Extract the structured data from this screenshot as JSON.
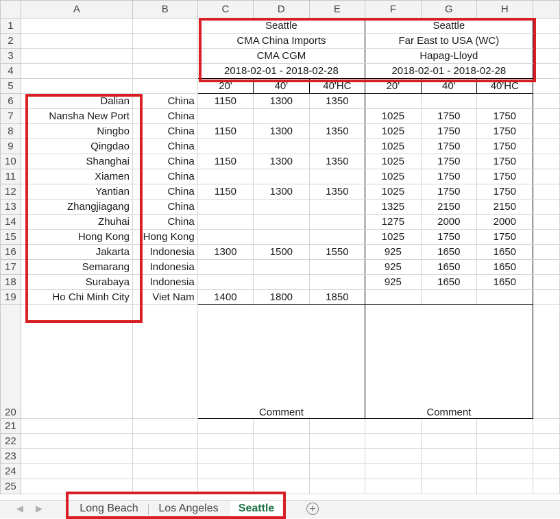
{
  "columns": [
    "A",
    "B",
    "C",
    "D",
    "E",
    "F",
    "G",
    "H"
  ],
  "rows": [
    "1",
    "2",
    "3",
    "4",
    "5",
    "6",
    "7",
    "8",
    "9",
    "10",
    "11",
    "12",
    "13",
    "14",
    "15",
    "16",
    "17",
    "18",
    "19",
    "20",
    "21",
    "22",
    "23",
    "24",
    "25"
  ],
  "header": {
    "left": {
      "city": "Seattle",
      "service": "CMA China Imports",
      "carrier": "CMA CGM",
      "period": "2018-02-01 - 2018-02-28"
    },
    "right": {
      "city": "Seattle",
      "service": "Far East to USA (WC)",
      "carrier": "Hapag-Lloyd",
      "period": "2018-02-01 - 2018-02-28"
    }
  },
  "container_sizes": [
    "20'",
    "40'",
    "40'HC",
    "20'",
    "40'",
    "40'HC"
  ],
  "ports": [
    {
      "port": "Dalian",
      "country": "China",
      "cma": [
        "1150",
        "1300",
        "1350"
      ],
      "hapag": [
        "",
        "",
        ""
      ]
    },
    {
      "port": "Nansha New Port",
      "country": "China",
      "cma": [
        "",
        "",
        ""
      ],
      "hapag": [
        "1025",
        "1750",
        "1750"
      ]
    },
    {
      "port": "Ningbo",
      "country": "China",
      "cma": [
        "1150",
        "1300",
        "1350"
      ],
      "hapag": [
        "1025",
        "1750",
        "1750"
      ]
    },
    {
      "port": "Qingdao",
      "country": "China",
      "cma": [
        "",
        "",
        ""
      ],
      "hapag": [
        "1025",
        "1750",
        "1750"
      ]
    },
    {
      "port": "Shanghai",
      "country": "China",
      "cma": [
        "1150",
        "1300",
        "1350"
      ],
      "hapag": [
        "1025",
        "1750",
        "1750"
      ]
    },
    {
      "port": "Xiamen",
      "country": "China",
      "cma": [
        "",
        "",
        ""
      ],
      "hapag": [
        "1025",
        "1750",
        "1750"
      ]
    },
    {
      "port": "Yantian",
      "country": "China",
      "cma": [
        "1150",
        "1300",
        "1350"
      ],
      "hapag": [
        "1025",
        "1750",
        "1750"
      ]
    },
    {
      "port": "Zhangjiagang",
      "country": "China",
      "cma": [
        "",
        "",
        ""
      ],
      "hapag": [
        "1325",
        "2150",
        "2150"
      ]
    },
    {
      "port": "Zhuhai",
      "country": "China",
      "cma": [
        "",
        "",
        ""
      ],
      "hapag": [
        "1275",
        "2000",
        "2000"
      ]
    },
    {
      "port": "Hong Kong",
      "country": "Hong Kong",
      "cma": [
        "",
        "",
        ""
      ],
      "hapag": [
        "1025",
        "1750",
        "1750"
      ]
    },
    {
      "port": "Jakarta",
      "country": "Indonesia",
      "cma": [
        "1300",
        "1500",
        "1550"
      ],
      "hapag": [
        "925",
        "1650",
        "1650"
      ]
    },
    {
      "port": "Semarang",
      "country": "Indonesia",
      "cma": [
        "",
        "",
        ""
      ],
      "hapag": [
        "925",
        "1650",
        "1650"
      ]
    },
    {
      "port": "Surabaya",
      "country": "Indonesia",
      "cma": [
        "",
        "",
        ""
      ],
      "hapag": [
        "925",
        "1650",
        "1650"
      ]
    },
    {
      "port": "Ho Chi Minh City",
      "country": "Viet Nam",
      "cma": [
        "1400",
        "1800",
        "1850"
      ],
      "hapag": [
        "",
        "",
        ""
      ]
    }
  ],
  "comment_label": "Comment",
  "sheet_tabs": [
    {
      "label": "Long Beach",
      "active": false
    },
    {
      "label": "Los Angeles",
      "active": false
    },
    {
      "label": "Seattle",
      "active": true
    }
  ],
  "nav": {
    "prev": "◀",
    "next": "▶",
    "add": "+"
  },
  "highlight_color": "#d81f26",
  "active_tab_color": "#217346"
}
